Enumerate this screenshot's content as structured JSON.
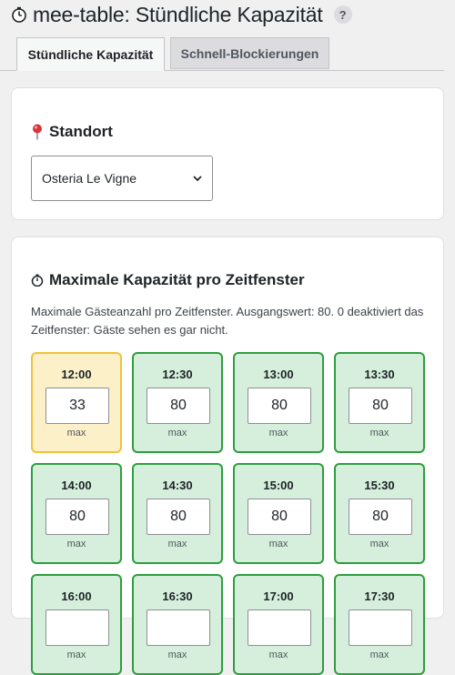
{
  "page": {
    "title": "mee-table: Stündliche Kapazität",
    "help_label": "?"
  },
  "tabs": [
    {
      "label": "Stündliche Kapazität",
      "active": true
    },
    {
      "label": "Schnell-Blockierungen",
      "active": false
    }
  ],
  "location": {
    "heading": "Standort",
    "selected": "Osteria Le Vigne"
  },
  "capacity": {
    "heading": "Maximale Kapazität pro Zeitfenster",
    "description": "Maximale Gästeanzahl pro Zeitfenster. Ausgangswert: 80. 0 deaktiviert das Zeitfenster: Gäste sehen es gar nicht.",
    "max_label": "max",
    "slots": [
      {
        "time": "12:00",
        "value": "33",
        "status": "warn"
      },
      {
        "time": "12:30",
        "value": "80",
        "status": "ok"
      },
      {
        "time": "13:00",
        "value": "80",
        "status": "ok"
      },
      {
        "time": "13:30",
        "value": "80",
        "status": "ok"
      },
      {
        "time": "14:00",
        "value": "80",
        "status": "ok"
      },
      {
        "time": "14:30",
        "value": "80",
        "status": "ok"
      },
      {
        "time": "15:00",
        "value": "80",
        "status": "ok"
      },
      {
        "time": "15:30",
        "value": "80",
        "status": "ok"
      },
      {
        "time": "16:00",
        "value": "",
        "status": "ok"
      },
      {
        "time": "16:30",
        "value": "",
        "status": "ok"
      },
      {
        "time": "17:00",
        "value": "",
        "status": "ok"
      },
      {
        "time": "17:30",
        "value": "",
        "status": "ok"
      }
    ]
  },
  "colors": {
    "ok_border": "#2e9e3e",
    "ok_bg": "#d6efdc",
    "warn_border": "#f0c33c",
    "warn_bg": "#fcf0c9"
  }
}
